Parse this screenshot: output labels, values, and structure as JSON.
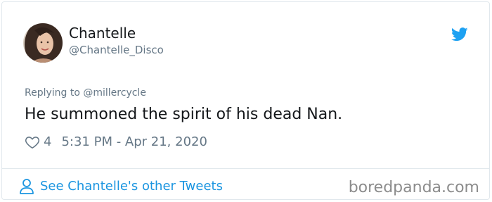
{
  "tweet": {
    "author_name": "Chantelle",
    "author_handle": "@Chantelle_Disco",
    "replying_to": "Replying to @millercycle",
    "text": "He summoned the spirit of his dead Nan.",
    "likes": "4",
    "timestamp": "5:31 PM - Apr 21, 2020"
  },
  "footer": {
    "other_tweets_label": "See Chantelle's other Tweets"
  },
  "watermark": "boredpanda.com",
  "icons": {
    "platform": "twitter-bird-icon",
    "like": "heart-outline-icon",
    "profile": "person-outline-icon"
  },
  "colors": {
    "link": "#1b95e0",
    "twitter_blue": "#1da1f2",
    "secondary_text": "#657786",
    "primary_text": "#14171a",
    "border": "#e1e8ed"
  }
}
